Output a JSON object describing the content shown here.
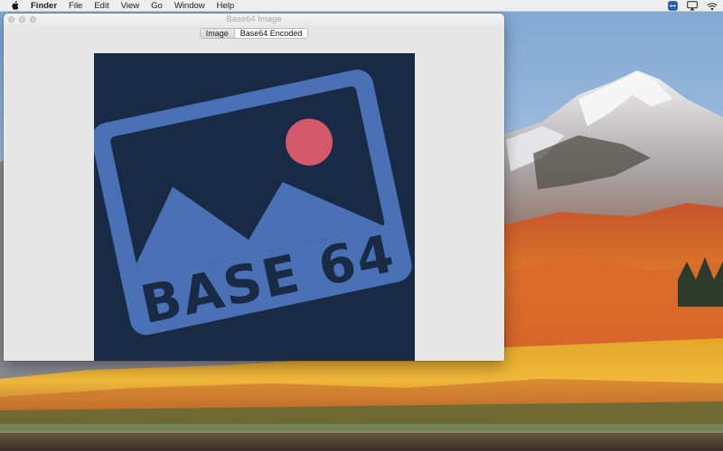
{
  "menubar": {
    "app_name": "Finder",
    "items": [
      "File",
      "Edit",
      "View",
      "Go",
      "Window",
      "Help"
    ],
    "icons": [
      "apple-icon",
      "teamviewer-icon",
      "airplay-icon",
      "wifi-icon"
    ]
  },
  "window": {
    "title": "Base64 Image",
    "tabs": [
      {
        "label": "Image",
        "selected": false
      },
      {
        "label": "Base64 Encoded",
        "selected": true
      }
    ],
    "image_logo_text": "BASE 64"
  },
  "colors": {
    "logo_background": "#192a45",
    "logo_blue": "#4a70b5",
    "logo_sun": "#d45a6b",
    "menubar_background": "#eeeeee",
    "window_background": "#e6e6e6"
  }
}
